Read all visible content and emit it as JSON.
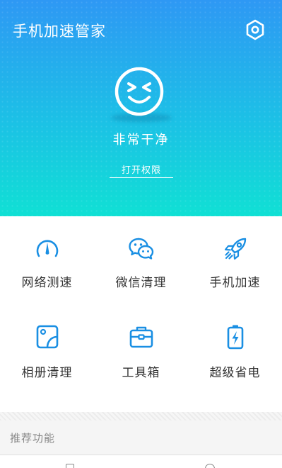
{
  "header": {
    "title": "手机加速管家",
    "settings_icon": "hexagon-settings-icon"
  },
  "status": {
    "face_icon": "smiley-face-icon",
    "text": "非常干净",
    "permission_link": "打开权限"
  },
  "tools": [
    {
      "label": "网络测速",
      "icon": "speedometer-icon"
    },
    {
      "label": "微信清理",
      "icon": "wechat-icon"
    },
    {
      "label": "手机加速",
      "icon": "rocket-icon"
    },
    {
      "label": "相册清理",
      "icon": "photo-album-icon"
    },
    {
      "label": "工具箱",
      "icon": "toolbox-icon"
    },
    {
      "label": "超级省电",
      "icon": "battery-charge-icon"
    }
  ],
  "recommend": {
    "title": "推荐功能"
  },
  "colors": {
    "hero_top": "#2e98f4",
    "hero_bottom": "#10e0d4",
    "icon_blue": "#1a8fe3",
    "label_text": "#333333"
  }
}
